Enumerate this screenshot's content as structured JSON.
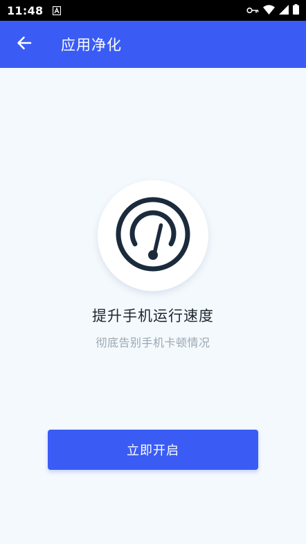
{
  "status_bar": {
    "time": "11:48",
    "icons": [
      "a-notification-icon",
      "key-icon",
      "wifi-icon",
      "signal-icon",
      "battery-icon"
    ]
  },
  "toolbar": {
    "title": "应用净化",
    "back_icon": "arrow-left-icon"
  },
  "hero": {
    "icon": "speedometer-icon",
    "title": "提升手机运行速度",
    "subtitle": "彻底告别手机卡顿情况"
  },
  "actions": {
    "start_label": "立即开启"
  },
  "colors": {
    "accent": "#3a5cf5",
    "background": "#f4f9fd",
    "gauge_stroke": "#1b2b3c",
    "subtitle_text": "#9aa7b3"
  }
}
